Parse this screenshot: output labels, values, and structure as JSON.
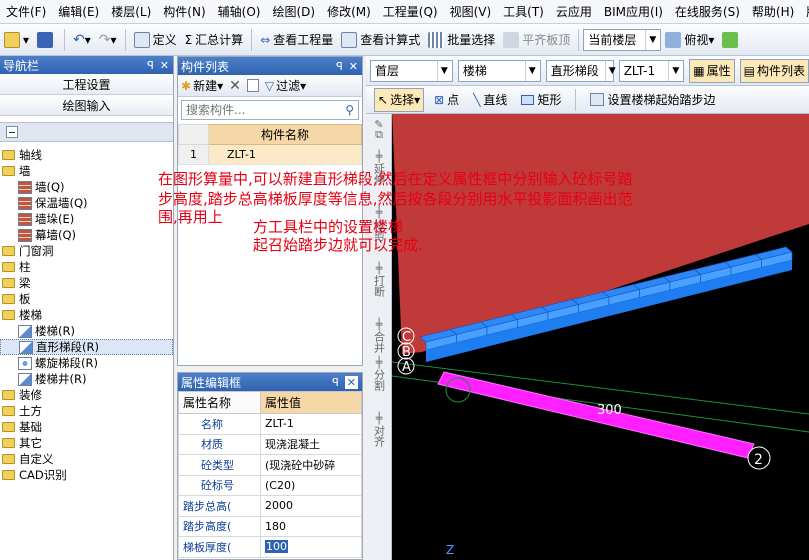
{
  "menu": [
    "文件(F)",
    "编辑(E)",
    "楼层(L)",
    "构件(N)",
    "辅轴(O)",
    "绘图(D)",
    "修改(M)",
    "工程量(Q)",
    "视图(V)",
    "工具(T)",
    "云应用",
    "BIM应用(I)",
    "在线服务(S)",
    "帮助(H)",
    "版本号(B)"
  ],
  "toolbar": {
    "define": "定义",
    "sum": "汇总计算",
    "view_qty": "查看工程量",
    "view_formula": "查看计算式",
    "batch_select": "批量选择",
    "align_slab": "平齐板顶",
    "current_floor": "当前楼层",
    "view_mode": "俯视"
  },
  "nav": {
    "title": "导航栏",
    "project_settings": "工程设置",
    "drawing_input": "绘图输入",
    "tree": [
      {
        "label": "轴线",
        "type": "folder"
      },
      {
        "label": "墙",
        "type": "folder"
      },
      {
        "label": "墙(Q)",
        "type": "child",
        "icon": "wall-icon"
      },
      {
        "label": "保温墙(Q)",
        "type": "child",
        "icon": "insulation-wall-icon"
      },
      {
        "label": "墙垛(E)",
        "type": "child",
        "icon": "wall-pier-icon"
      },
      {
        "label": "幕墙(Q)",
        "type": "child",
        "icon": "curtain-wall-icon"
      },
      {
        "label": "门窗洞",
        "type": "folder"
      },
      {
        "label": "柱",
        "type": "folder"
      },
      {
        "label": "梁",
        "type": "folder"
      },
      {
        "label": "板",
        "type": "folder"
      },
      {
        "label": "楼梯",
        "type": "folder"
      },
      {
        "label": "楼梯(R)",
        "type": "child",
        "icon": "stair-icon"
      },
      {
        "label": "直形梯段(R)",
        "type": "child",
        "icon": "straight-flight-icon",
        "selected": true
      },
      {
        "label": "螺旋梯段(R)",
        "type": "child",
        "icon": "spiral-flight-icon"
      },
      {
        "label": "楼梯井(R)",
        "type": "child",
        "icon": "stairwell-icon"
      },
      {
        "label": "装修",
        "type": "folder"
      },
      {
        "label": "土方",
        "type": "folder"
      },
      {
        "label": "基础",
        "type": "folder"
      },
      {
        "label": "其它",
        "type": "folder"
      },
      {
        "label": "自定义",
        "type": "folder"
      },
      {
        "label": "CAD识别",
        "type": "folder"
      }
    ]
  },
  "complist": {
    "title": "构件列表",
    "new_label": "新建",
    "filter_label": "过滤",
    "search_placeholder": "搜索构件...",
    "header": "构件名称",
    "rows": [
      {
        "index": "1",
        "name": "ZLT-1"
      }
    ]
  },
  "props": {
    "title": "属性编辑框",
    "col_name": "属性名称",
    "col_value": "属性值",
    "rows": [
      {
        "key": "名称",
        "value": "ZLT-1",
        "indent": true
      },
      {
        "key": "材质",
        "value": "现浇混凝土",
        "indent": true
      },
      {
        "key": "砼类型",
        "value": "(现浇砼中砂碎",
        "indent": true
      },
      {
        "key": "砼标号",
        "value": "(C20)",
        "indent": true
      },
      {
        "key": "踏步总高(",
        "value": "2000",
        "indent": false
      },
      {
        "key": "踏步高度(",
        "value": "180",
        "indent": false
      },
      {
        "key": "梯板厚度(",
        "value": "100",
        "indent": false,
        "editing": true
      }
    ]
  },
  "right_toolbar": {
    "floor": "首层",
    "category": "楼梯",
    "type": "直形梯段",
    "component": "ZLT-1",
    "property_btn": "属性",
    "complist_btn": "构件列表",
    "select": "选择",
    "point": "点",
    "line": "直线",
    "rect": "矩形",
    "set_start": "设置楼梯起始踏步边"
  },
  "vtools": [
    "延伸",
    "修剪",
    "打断",
    "合并",
    "分割",
    "对齐"
  ],
  "canvas": {
    "axis_labels": [
      "C",
      "B",
      "A"
    ],
    "dim_text": "300",
    "marker": "2",
    "axis_z": "Z",
    "step_count": 12,
    "colors": {
      "plane": "#c03a3a",
      "steps": "#1e7df0",
      "beam": "#ff20ff"
    }
  },
  "annotation": {
    "line1": "在图形算量中,可以新建直形梯段,然后在定义属性框中分别输入砼标号踏",
    "line2": "步高度,踏步总高梯板厚度等信息,然后按各段分别用水平投影面积画出范",
    "line3": "围,再用上",
    "line4": "方工具栏中的设置楼梯",
    "line5": "起召始踏步边就可以完成."
  }
}
